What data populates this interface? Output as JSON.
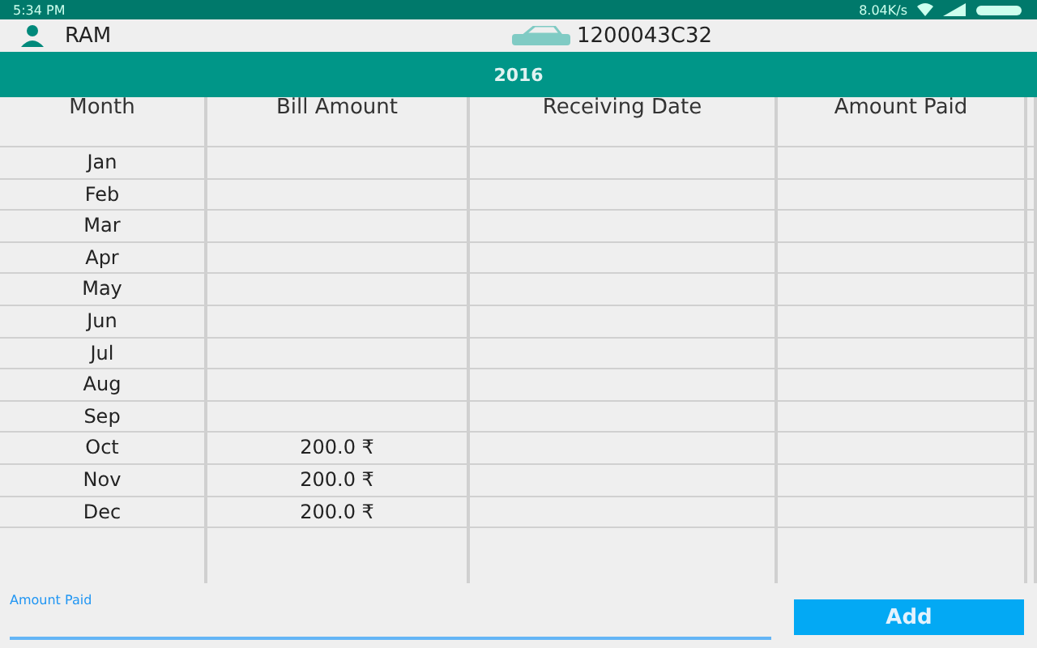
{
  "status_bar": {
    "time": "5:34 PM",
    "speed": "8.04K/s"
  },
  "account": {
    "name": "RAM",
    "number": "1200043C32"
  },
  "year": "2016",
  "table": {
    "columns": [
      "Month",
      "Bill Amount",
      "Receiving Date",
      "Amount Paid"
    ],
    "rows": [
      {
        "month": "Jan"
      },
      {
        "month": "Feb"
      },
      {
        "month": "Mar"
      },
      {
        "month": "Apr"
      },
      {
        "month": "May"
      },
      {
        "month": "Jun"
      },
      {
        "month": "Jul"
      },
      {
        "month": "Aug"
      },
      {
        "month": "Sep"
      },
      {
        "month": "Oct",
        "bill_amount": "200.0 ₹"
      },
      {
        "month": "Nov",
        "bill_amount": "200.0 ₹"
      },
      {
        "month": "Dec",
        "bill_amount": "200.0 ₹"
      }
    ]
  },
  "amount_field": {
    "placeholder": "Amount Paid"
  },
  "add_button": "Add"
}
